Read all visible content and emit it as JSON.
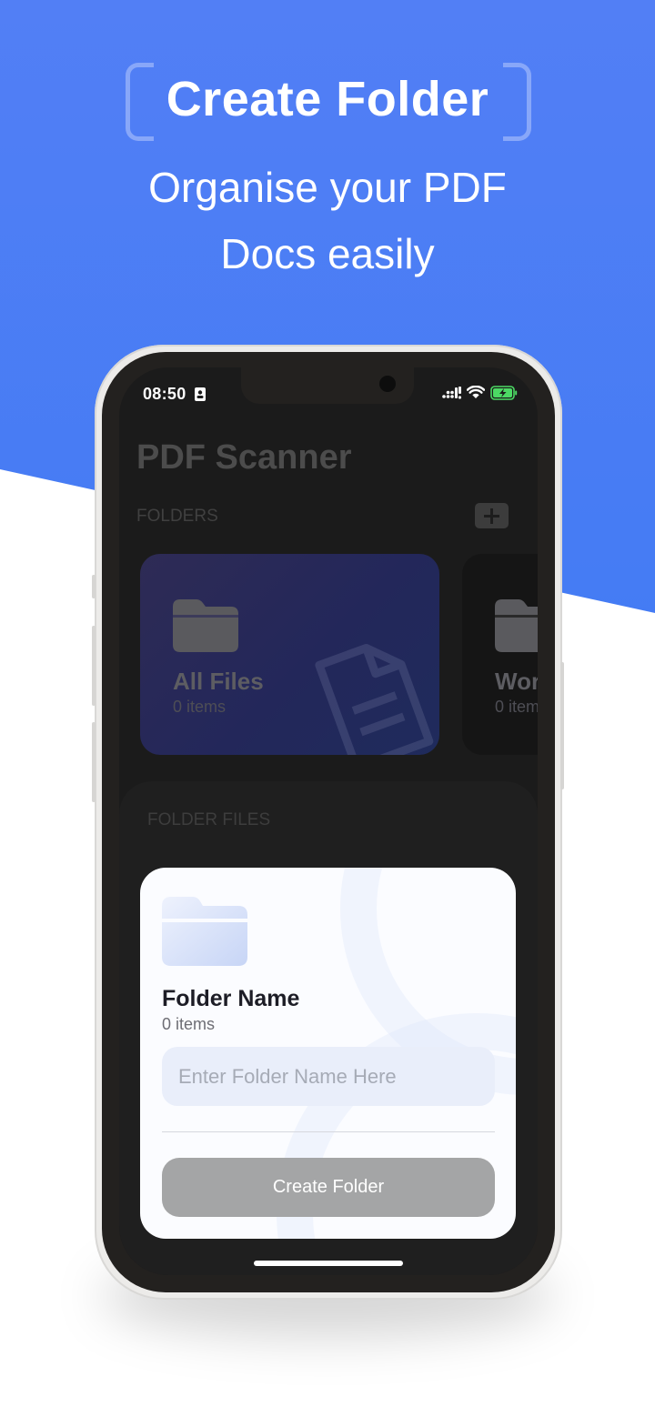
{
  "promo": {
    "headline": "Create Folder",
    "subtitle_line1": "Organise your PDF",
    "subtitle_line2": "Docs easily"
  },
  "status_bar": {
    "time": "08:50",
    "icons": [
      "contact-card-icon",
      "signal-icon",
      "wifi-icon",
      "battery-charging-icon"
    ],
    "battery_color": "#4cd964"
  },
  "app": {
    "title": "PDF Scanner",
    "folders_label": "FOLDERS",
    "folder_files_label": "FOLDER FILES",
    "folders": [
      {
        "name": "All Files",
        "count": "0 items"
      },
      {
        "name": "Wor",
        "count": "0 item"
      }
    ]
  },
  "dialog": {
    "title": "Folder Name",
    "count": "0 items",
    "input_value": "",
    "input_placeholder": "Enter Folder Name Here",
    "button_label": "Create Folder"
  },
  "colors": {
    "brand_blue": "#4a7ef5",
    "button_disabled": "#a4a5a6",
    "input_bg": "#e9eefa"
  }
}
